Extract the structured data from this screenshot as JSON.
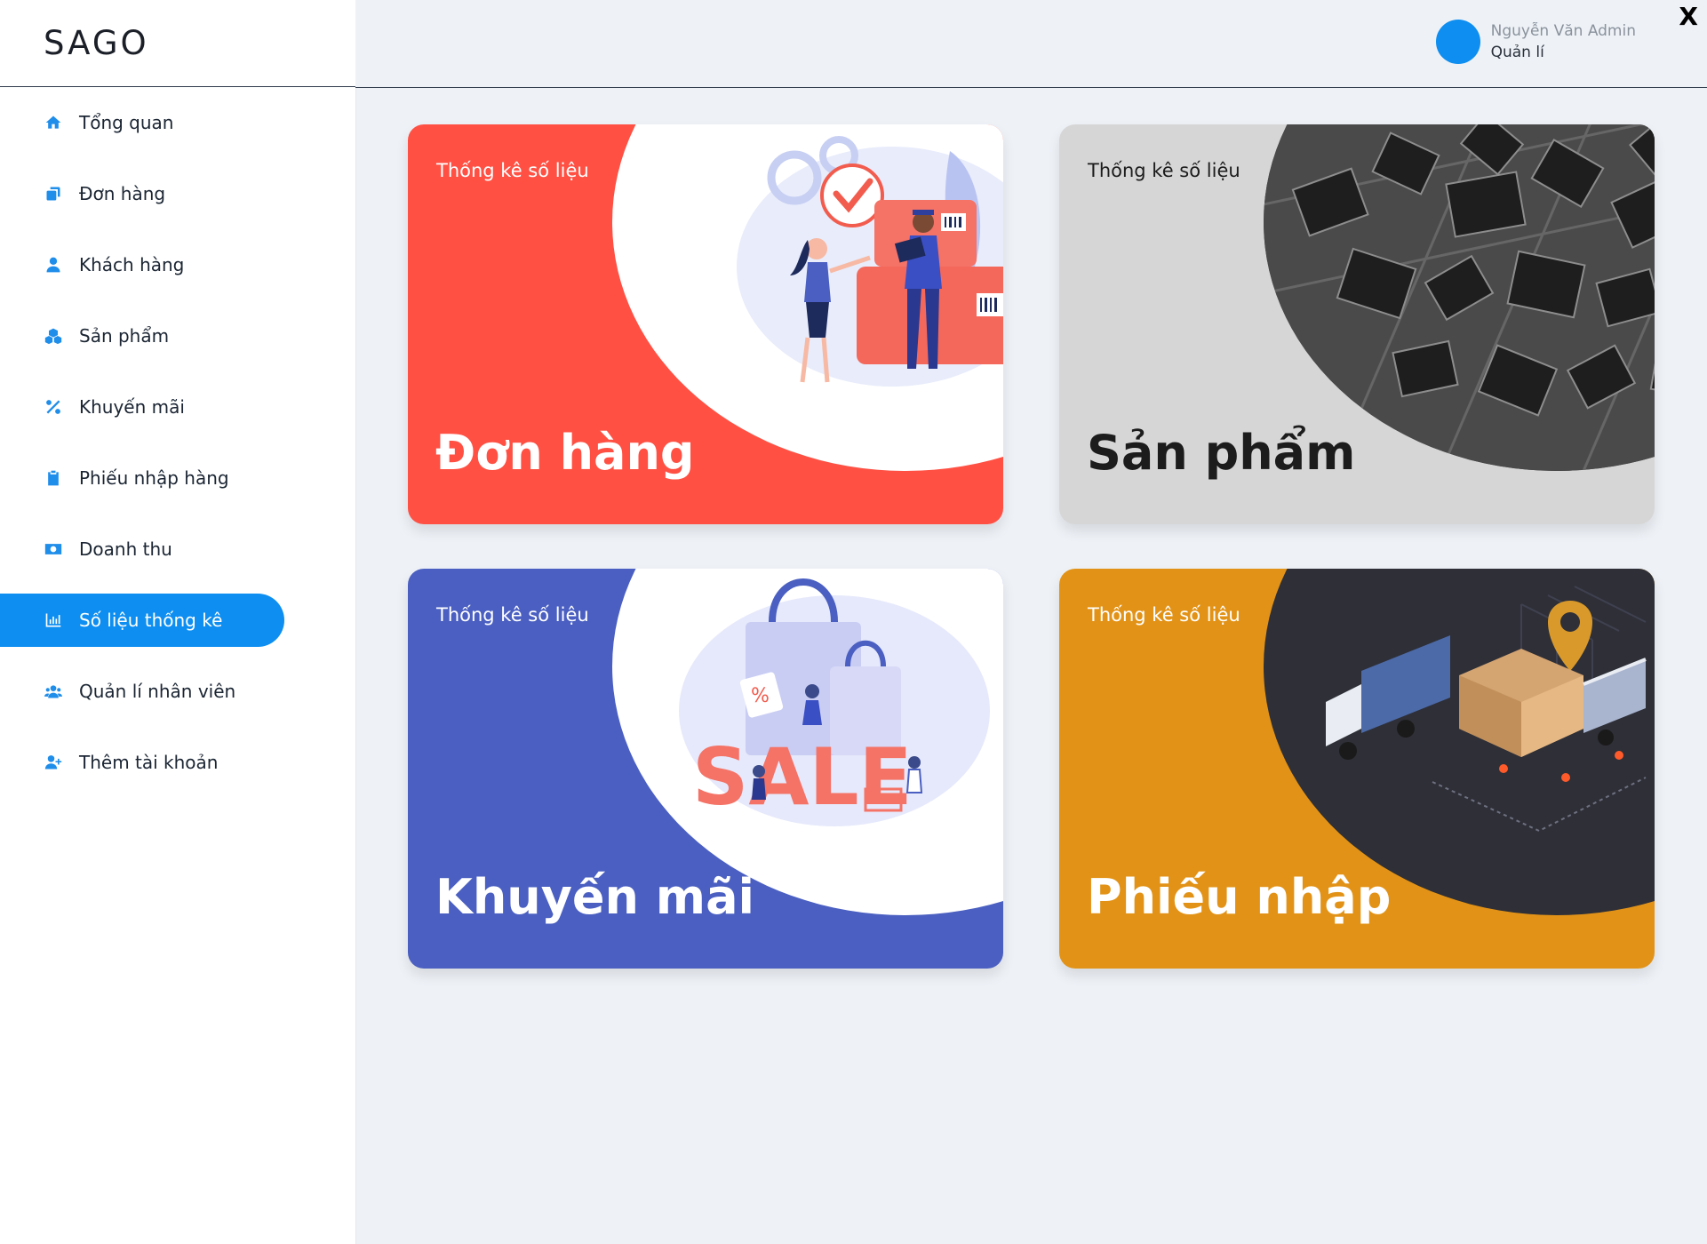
{
  "brand": {
    "logo": "SAGO"
  },
  "user": {
    "name": "Nguyễn Văn Admin",
    "role": "Quản lí"
  },
  "close_label": "X",
  "sidebar": {
    "items": [
      {
        "label": "Tổng quan",
        "icon": "home-icon",
        "active": false
      },
      {
        "label": "Đơn hàng",
        "icon": "copy-icon",
        "active": false
      },
      {
        "label": "Khách hàng",
        "icon": "user-icon",
        "active": false
      },
      {
        "label": "Sản phẩm",
        "icon": "cubes-icon",
        "active": false
      },
      {
        "label": "Khuyến mãi",
        "icon": "percent-icon",
        "active": false
      },
      {
        "label": "Phiếu nhập hàng",
        "icon": "clipboard-icon",
        "active": false
      },
      {
        "label": "Doanh thu",
        "icon": "money-bill-icon",
        "active": false
      },
      {
        "label": "Số liệu thống kê",
        "icon": "chart-bar-icon",
        "active": true
      },
      {
        "label": "Quản lí nhân viên",
        "icon": "users-icon",
        "active": false
      },
      {
        "label": "Thêm tài khoản",
        "icon": "user-plus-icon",
        "active": false
      }
    ]
  },
  "cards": [
    {
      "kicker": "Thống kê số liệu",
      "title": "Đơn hàng",
      "color": "#ff5043",
      "illustration": "delivery-illustration"
    },
    {
      "kicker": "Thống kê số liệu",
      "title": "Sản phẩm",
      "color": "#d6d6d6",
      "illustration": "books-photo"
    },
    {
      "kicker": "Thống kê số liệu",
      "title": "Khuyến mãi",
      "color": "#4a5fc1",
      "illustration": "sale-illustration"
    },
    {
      "kicker": "Thống kê số liệu",
      "title": "Phiếu nhập",
      "color": "#e29317",
      "illustration": "warehouse-illustration"
    }
  ],
  "colors": {
    "accent": "#0d8ef0",
    "background": "#eef2f7"
  }
}
